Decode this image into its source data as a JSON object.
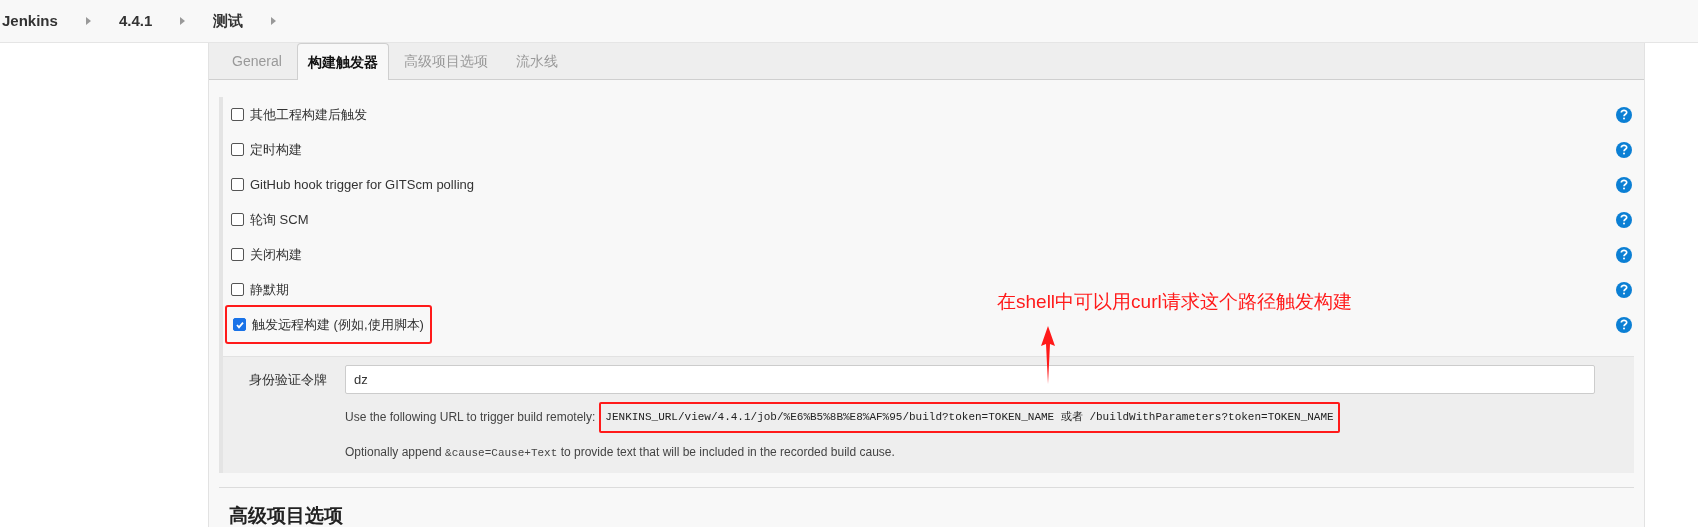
{
  "breadcrumb": [
    {
      "label": "Jenkins"
    },
    {
      "label": "4.4.1"
    },
    {
      "label": "测试"
    }
  ],
  "tabs": [
    {
      "label": "General",
      "selected": false
    },
    {
      "label": "构建触发器",
      "selected": true
    },
    {
      "label": "高级项目选项",
      "selected": false
    },
    {
      "label": "流水线",
      "selected": false
    }
  ],
  "triggers": [
    {
      "label": "其他工程构建后触发",
      "checked": false,
      "highlighted": false
    },
    {
      "label": "定时构建",
      "checked": false,
      "highlighted": false
    },
    {
      "label": "GitHub hook trigger for GITScm polling",
      "checked": false,
      "highlighted": false
    },
    {
      "label": "轮询 SCM",
      "checked": false,
      "highlighted": false
    },
    {
      "label": "关闭构建",
      "checked": false,
      "highlighted": false
    },
    {
      "label": "静默期",
      "checked": false,
      "highlighted": false
    },
    {
      "label": "触发远程构建 (例如,使用脚本)",
      "checked": true,
      "highlighted": true
    }
  ],
  "remote_trigger": {
    "token_label": "身份验证令牌",
    "token_value": "dz",
    "url_intro": "Use the following URL to trigger build remotely:",
    "url": "JENKINS_URL/view/4.4.1/job/%E6%B5%8B%E8%AF%95/build?token=TOKEN_NAME 或者 /buildWithParameters?token=TOKEN_NAME",
    "url_highlighted": true,
    "hint_before": "Optionally append",
    "hint_code": "&cause=Cause+Text",
    "hint_after": "to provide text that will be included in the recorded build cause."
  },
  "section_heading": "高级项目选项",
  "annotation": {
    "text": "在shell中可以用curl请求这个路径触发构建"
  }
}
